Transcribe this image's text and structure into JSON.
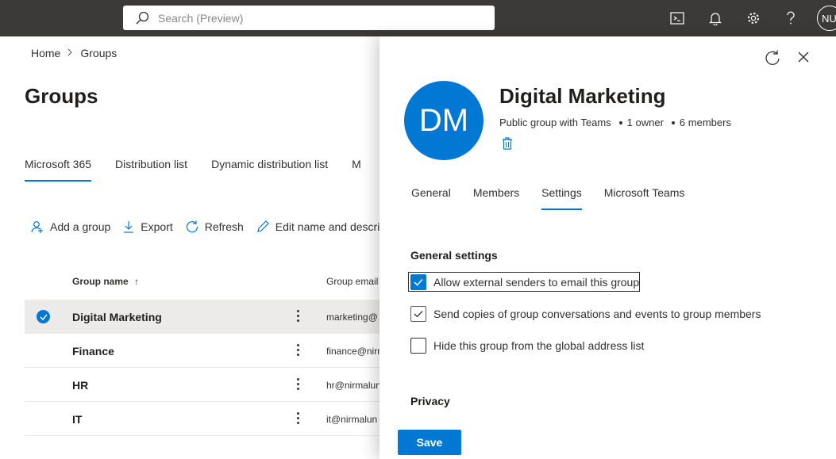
{
  "topbar": {
    "search_placeholder": "Search (Preview)",
    "avatar_initials": "NU"
  },
  "breadcrumb": {
    "home": "Home",
    "current": "Groups"
  },
  "page": {
    "title": "Groups",
    "tabs": [
      {
        "label": "Microsoft 365",
        "active": true
      },
      {
        "label": "Distribution list"
      },
      {
        "label": "Dynamic distribution list"
      },
      {
        "label": "M"
      }
    ],
    "toolbar": {
      "add_group": "Add a group",
      "export": "Export",
      "refresh": "Refresh",
      "edit_name": "Edit name and descrip"
    },
    "table": {
      "col_name": "Group name",
      "col_email": "Group email",
      "rows": [
        {
          "name": "Digital Marketing",
          "email": "marketing@",
          "selected": true
        },
        {
          "name": "Finance",
          "email": "finance@nirr"
        },
        {
          "name": "HR",
          "email": "hr@nirmalun"
        },
        {
          "name": "IT",
          "email": "it@nirmalun"
        }
      ]
    }
  },
  "panel": {
    "initials": "DM",
    "group_name": "Digital Marketing",
    "group_type": "Public group with Teams",
    "owners": "1 owner",
    "members": "6 members",
    "tabs": [
      {
        "label": "General"
      },
      {
        "label": "Members"
      },
      {
        "label": "Settings",
        "active": true
      },
      {
        "label": "Microsoft Teams"
      }
    ],
    "general_settings_title": "General settings",
    "options": [
      {
        "label": "Allow external senders to email this group",
        "checked": true
      },
      {
        "label": "Send copies of group conversations and events to group members",
        "checked": true
      },
      {
        "label": "Hide this group from the global address list",
        "checked": false
      }
    ],
    "privacy_title": "Privacy",
    "save_label": "Save"
  },
  "colors": {
    "accent": "#0078d4",
    "topbar": "#3b3a39"
  }
}
